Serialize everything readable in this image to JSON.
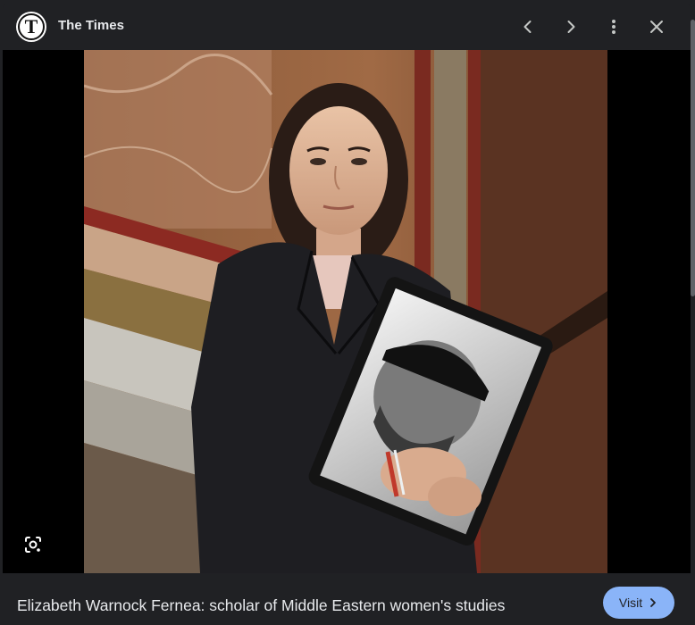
{
  "header": {
    "logo_letter": "T",
    "site_name": "The Times",
    "icons": [
      "chevron-left-icon",
      "chevron-right-icon",
      "more-vert-icon",
      "close-icon"
    ]
  },
  "image": {
    "alt": "Woman in dark suit holding framed portrait",
    "lens_icon": "google-lens-icon"
  },
  "footer": {
    "caption": "Elizabeth Warnock Fernea: scholar of Middle Eastern women's studies",
    "visit_label": "Visit",
    "visit_icon": "chevron-right-icon"
  },
  "colors": {
    "background": "#202124",
    "text": "#e8eaed",
    "accent": "#8ab4f8"
  }
}
